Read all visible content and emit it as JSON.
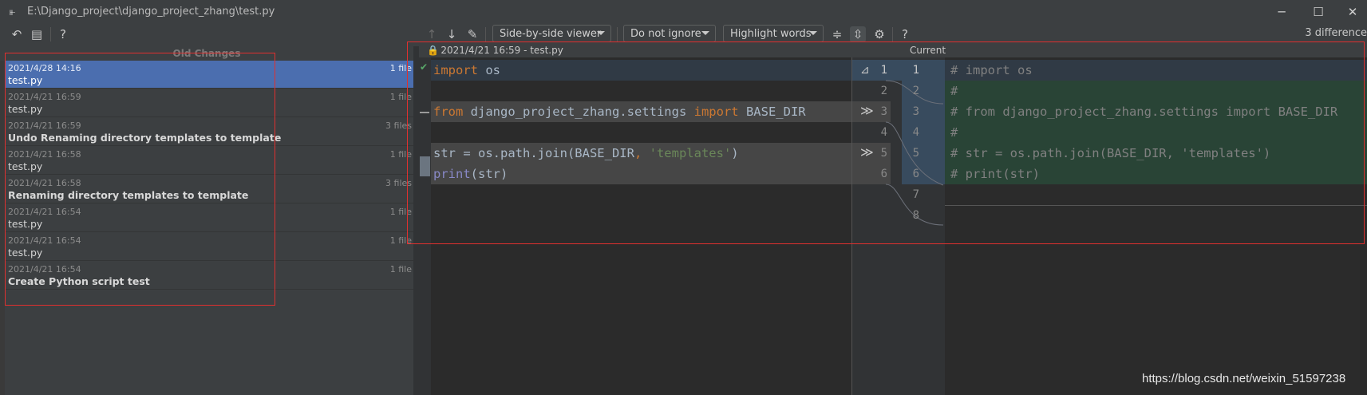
{
  "window": {
    "title": "E:\\Django_project\\django_project_zhang\\test.py",
    "minimize_icon": "minimize-icon",
    "maximize_icon": "maximize-icon",
    "close_icon": "close-icon"
  },
  "toolbar": {
    "viewer_mode": "Side-by-side viewer",
    "whitespace_mode": "Do not ignore",
    "highlight_mode": "Highlight words",
    "help": "?",
    "differences": "3 difference"
  },
  "left_panel": {
    "header": "Old Changes",
    "help": "?",
    "revisions": [
      {
        "date": "2021/4/28 14:16",
        "name": "test.py",
        "count": "1 file",
        "bold": false,
        "selected": true
      },
      {
        "date": "2021/4/21 16:59",
        "name": "test.py",
        "count": "1 file",
        "bold": false,
        "selected": false
      },
      {
        "date": "2021/4/21 16:59",
        "name": "Undo Renaming directory templates to template",
        "count": "3 files",
        "bold": true,
        "selected": false
      },
      {
        "date": "2021/4/21 16:58",
        "name": "test.py",
        "count": "1 file",
        "bold": false,
        "selected": false
      },
      {
        "date": "2021/4/21 16:58",
        "name": "Renaming directory templates to template",
        "count": "3 files",
        "bold": true,
        "selected": false
      },
      {
        "date": "2021/4/21 16:54",
        "name": "test.py",
        "count": "1 file",
        "bold": false,
        "selected": false
      },
      {
        "date": "2021/4/21 16:54",
        "name": "test.py",
        "count": "1 file",
        "bold": false,
        "selected": false
      },
      {
        "date": "2021/4/21 16:54",
        "name": "Create Python script test",
        "count": "1 file",
        "bold": true,
        "selected": false
      }
    ]
  },
  "diff": {
    "left_header": "2021/4/21 16:59 - test.py",
    "right_header": "Current",
    "left_lines": [
      {
        "num": "1",
        "text": "import os"
      },
      {
        "num": "2",
        "text": ""
      },
      {
        "num": "3",
        "text": "from django_project_zhang.settings import BASE_DIR"
      },
      {
        "num": "4",
        "text": ""
      },
      {
        "num": "5",
        "text": "str = os.path.join(BASE_DIR, 'templates')"
      },
      {
        "num": "6",
        "text": "print(str)"
      }
    ],
    "right_lines": [
      {
        "num": "1",
        "text": "# import os"
      },
      {
        "num": "2",
        "text": "#"
      },
      {
        "num": "3",
        "text": "# from django_project_zhang.settings import BASE_DIR"
      },
      {
        "num": "4",
        "text": "#"
      },
      {
        "num": "5",
        "text": "# str = os.path.join(BASE_DIR, 'templates')"
      },
      {
        "num": "6",
        "text": "# print(str)"
      },
      {
        "num": "7",
        "text": ""
      },
      {
        "num": "8",
        "text": ""
      }
    ]
  },
  "watermark": "https://blog.csdn.net/weixin_51597238",
  "colors": {
    "selection": "#4b6eaf",
    "modified_bg": "#384b5e",
    "inserted_bg": "#294436",
    "changed_left_bg": "#464646",
    "highlight_box": "#e0302f"
  }
}
